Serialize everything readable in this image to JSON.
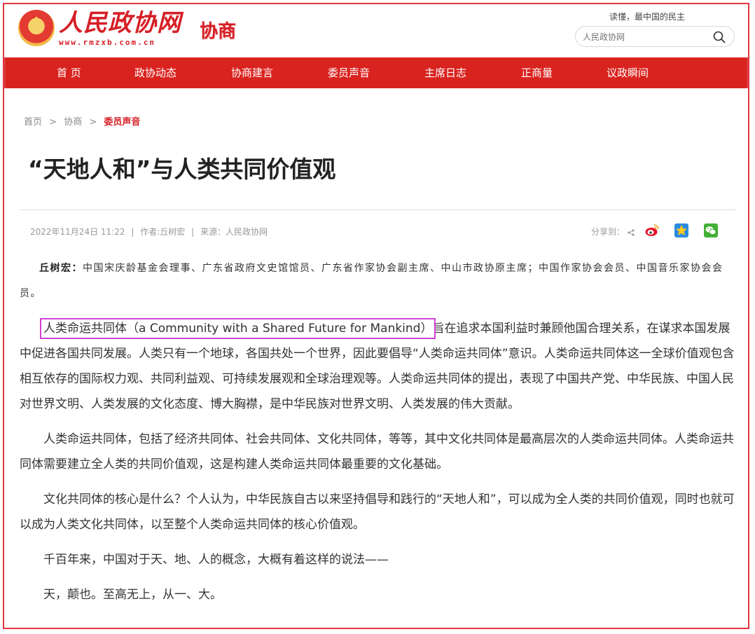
{
  "header": {
    "logo_text": "人民政协网",
    "logo_url": "www.rmzxb.com.cn",
    "section_tag": "协商",
    "slogan": "读懂，最中国的民主",
    "search_placeholder": "人民政协网"
  },
  "nav": {
    "items": [
      "首 页",
      "政协动态",
      "协商建言",
      "委员声音",
      "主席日志",
      "正商量",
      "议政瞬间"
    ]
  },
  "breadcrumb": {
    "home": "首页",
    "section": "协商",
    "current": "委员声音",
    "separator": ">"
  },
  "article": {
    "title": "“天地人和”与人类共同价值观",
    "date": "2022年11月24日 11:22",
    "author": "作者:丘树宏",
    "source": "来源：人民政协网",
    "meta_separator": "|",
    "share_label": "分享到：",
    "share_icons": [
      "weibo-icon",
      "qzone-icon",
      "wechat-icon"
    ],
    "author_name": "丘树宏：",
    "author_bio": "中国宋庆龄基金会理事、广东省政府文史馆馆员、广东省作家协会副主席、中山市政协原主席；中国作家协会会员、中国音乐家协会会员。",
    "highlight": "人类命运共同体（a Community with a Shared Future for Mankind）",
    "p1_rest": "旨在追求本国利益时兼顾他国合理关系，在谋求本国发展中促进各国共同发展。人类只有一个地球，各国共处一个世界，因此要倡导“人类命运共同体”意识。人类命运共同体这一全球价值观包含相互依存的国际权力观、共同利益观、可持续发展观和全球治理观等。人类命运共同体的提出，表现了中国共产党、中华民族、中国人民对世界文明、人类发展的文化态度、博大胸襟，是中华民族对世界文明、人类发展的伟大贡献。",
    "p2": "人类命运共同体，包括了经济共同体、社会共同体、文化共同体，等等，其中文化共同体是最高层次的人类命运共同体。人类命运共同体需要建立全人类的共同价值观，这是构建人类命运共同体最重要的文化基础。",
    "p3": "文化共同体的核心是什么？个人认为，中华民族自古以来坚持倡导和践行的“天地人和”，可以成为全人类的共同价值观，同时也就可以成为人类文化共同体，以至整个人类命运共同体的核心价值观。",
    "p4": "千百年来，中国对于天、地、人的概念，大概有着这样的说法——",
    "p5": "天，颠也。至高无上，从一、大。"
  },
  "colors": {
    "brand_red": "#d9231f",
    "highlight_box": "#d042d6"
  }
}
